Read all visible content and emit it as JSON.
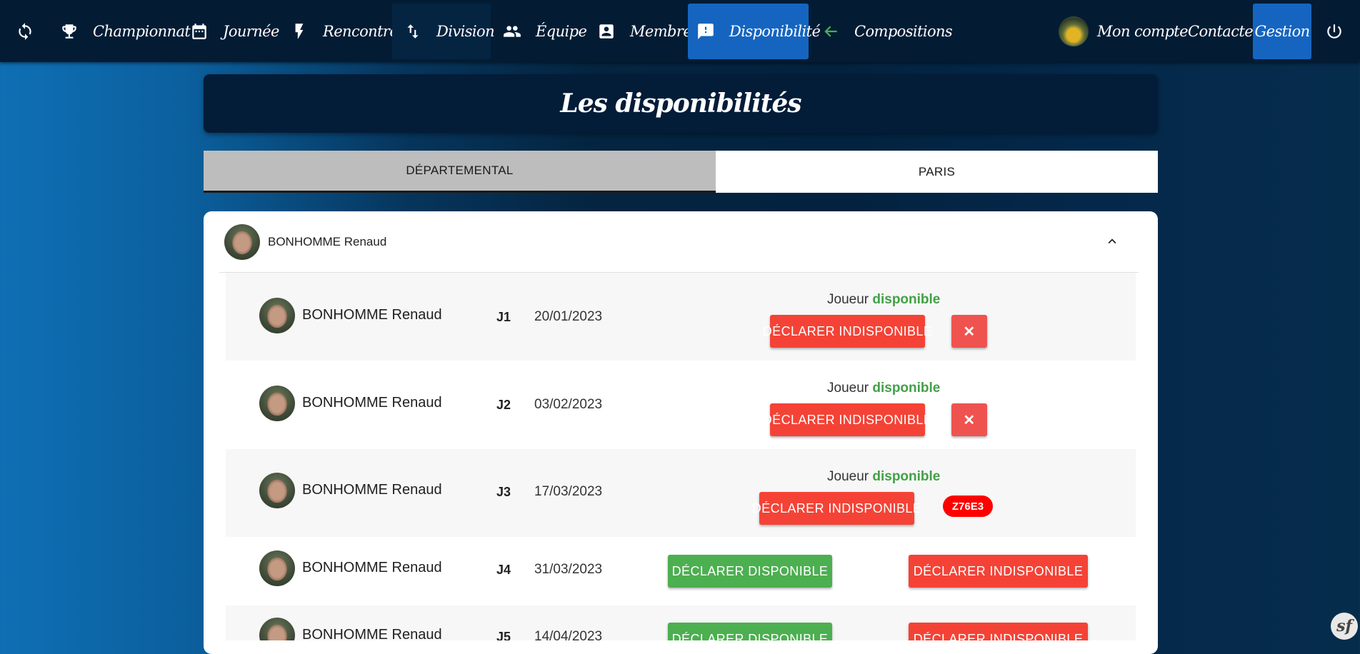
{
  "nav": {
    "items": [
      {
        "label": ""
      },
      {
        "label": "Championnat"
      },
      {
        "label": "Journée"
      },
      {
        "label": "Rencontre"
      },
      {
        "label": "Division"
      },
      {
        "label": "Équipe"
      },
      {
        "label": "Membre"
      },
      {
        "label": "Disponibilité"
      },
      {
        "label": "Compositions"
      }
    ],
    "right": {
      "account": "Mon compte",
      "contact": "Contacter",
      "gestion": "Gestion"
    }
  },
  "page": {
    "title": "Les disponibilités"
  },
  "tabs": [
    "DÉPARTEMENTAL",
    "PARIS"
  ],
  "card": {
    "header_name": "BONHOMME Renaud",
    "rows": [
      {
        "name": "BONHOMME Renaud",
        "journee": "J1",
        "date": "20/01/2023",
        "status_prefix": "Joueur ",
        "status_value": "disponible",
        "btn1": "DÉCLARER INDISPONIBLE",
        "btn2": "✕"
      },
      {
        "name": "BONHOMME Renaud",
        "journee": "J2",
        "date": "03/02/2023",
        "status_prefix": "Joueur ",
        "status_value": "disponible",
        "btn1": "DÉCLARER INDISPONIBLE",
        "btn2": "✕"
      },
      {
        "name": "BONHOMME Renaud",
        "journee": "J3",
        "date": "17/03/2023",
        "status_prefix": "Joueur ",
        "status_value": "disponible",
        "btn1": "DÉCLARER INDISPONIBLE",
        "badge": "Z76E3"
      },
      {
        "name": "BONHOMME Renaud",
        "journee": "J4",
        "date": "31/03/2023",
        "btn_dispo": "DÉCLARER DISPONIBLE",
        "btn_indispo": "DÉCLARER INDISPONIBLE"
      },
      {
        "name": "BONHOMME Renaud",
        "journee": "J5",
        "date": "14/04/2023",
        "btn_dispo": "DÉCLARER DISPONIBLE",
        "btn_indispo": "DÉCLARER INDISPONIBLE"
      }
    ]
  },
  "colors": {
    "nav_bg": "#031c34",
    "active": "#1565c0",
    "red": "#f44336",
    "green": "#4caf50",
    "available_text": "#43a047",
    "badge": "#ff0000"
  },
  "footer": {
    "symfony_glyph": "sf"
  }
}
